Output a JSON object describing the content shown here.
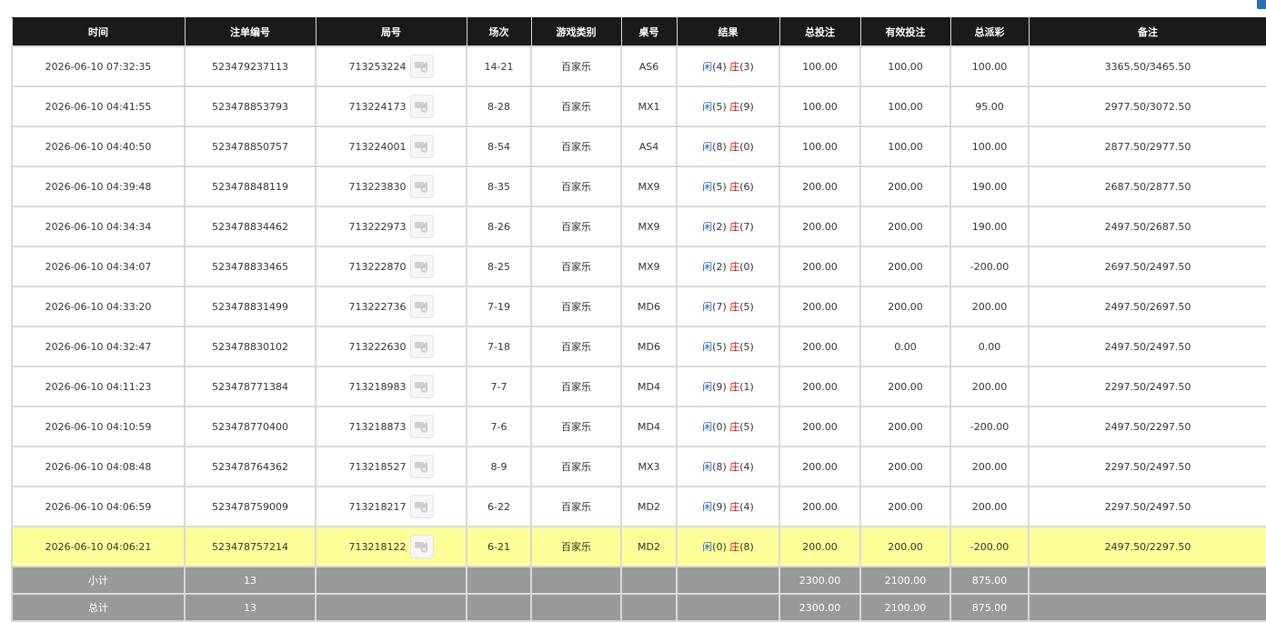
{
  "headers": [
    "时间",
    "注单编号",
    "局号",
    "场次",
    "游戏类别",
    "桌号",
    "结果",
    "总投注",
    "有效投注",
    "总派彩",
    "备注"
  ],
  "rows": [
    {
      "time": "2026-06-10 07:32:35",
      "bet_id": "523479237113",
      "round": "713253224",
      "session": "14-21",
      "game": "百家乐",
      "table": "AS6",
      "player_label": "闲",
      "player_val": "(4)",
      "banker_label": "庄",
      "banker_val": "(3)",
      "total_bet": "100.00",
      "valid_bet": "100.00",
      "payout": "100.00",
      "payout_neg": false,
      "note": "3365.50/3465.50",
      "highlight": false
    },
    {
      "time": "2026-06-10 04:41:55",
      "bet_id": "523478853793",
      "round": "713224173",
      "session": "8-28",
      "game": "百家乐",
      "table": "MX1",
      "player_label": "闲",
      "player_val": "(5)",
      "banker_label": "庄",
      "banker_val": "(9)",
      "total_bet": "100.00",
      "valid_bet": "100.00",
      "payout": "95.00",
      "payout_neg": false,
      "note": "2977.50/3072.50",
      "highlight": false
    },
    {
      "time": "2026-06-10 04:40:50",
      "bet_id": "523478850757",
      "round": "713224001",
      "session": "8-54",
      "game": "百家乐",
      "table": "AS4",
      "player_label": "闲",
      "player_val": "(8)",
      "banker_label": "庄",
      "banker_val": "(0)",
      "total_bet": "100.00",
      "valid_bet": "100.00",
      "payout": "100.00",
      "payout_neg": false,
      "note": "2877.50/2977.50",
      "highlight": false
    },
    {
      "time": "2026-06-10 04:39:48",
      "bet_id": "523478848119",
      "round": "713223830",
      "session": "8-35",
      "game": "百家乐",
      "table": "MX9",
      "player_label": "闲",
      "player_val": "(5)",
      "banker_label": "庄",
      "banker_val": "(6)",
      "total_bet": "200.00",
      "valid_bet": "200.00",
      "payout": "190.00",
      "payout_neg": false,
      "note": "2687.50/2877.50",
      "highlight": false
    },
    {
      "time": "2026-06-10 04:34:34",
      "bet_id": "523478834462",
      "round": "713222973",
      "session": "8-26",
      "game": "百家乐",
      "table": "MX9",
      "player_label": "闲",
      "player_val": "(2)",
      "banker_label": "庄",
      "banker_val": "(7)",
      "total_bet": "200.00",
      "valid_bet": "200.00",
      "payout": "190.00",
      "payout_neg": false,
      "note": "2497.50/2687.50",
      "highlight": false
    },
    {
      "time": "2026-06-10 04:34:07",
      "bet_id": "523478833465",
      "round": "713222870",
      "session": "8-25",
      "game": "百家乐",
      "table": "MX9",
      "player_label": "闲",
      "player_val": "(2)",
      "banker_label": "庄",
      "banker_val": "(0)",
      "total_bet": "200.00",
      "valid_bet": "200.00",
      "payout": "-200.00",
      "payout_neg": true,
      "note": "2697.50/2497.50",
      "highlight": false
    },
    {
      "time": "2026-06-10 04:33:20",
      "bet_id": "523478831499",
      "round": "713222736",
      "session": "7-19",
      "game": "百家乐",
      "table": "MD6",
      "player_label": "闲",
      "player_val": "(7)",
      "banker_label": "庄",
      "banker_val": "(5)",
      "total_bet": "200.00",
      "valid_bet": "200.00",
      "payout": "200.00",
      "payout_neg": false,
      "note": "2497.50/2697.50",
      "highlight": false
    },
    {
      "time": "2026-06-10 04:32:47",
      "bet_id": "523478830102",
      "round": "713222630",
      "session": "7-18",
      "game": "百家乐",
      "table": "MD6",
      "player_label": "闲",
      "player_val": "(5)",
      "banker_label": "庄",
      "banker_val": "(5)",
      "total_bet": "200.00",
      "valid_bet": "0.00",
      "payout": "0.00",
      "payout_neg": false,
      "note": "2497.50/2497.50",
      "highlight": false
    },
    {
      "time": "2026-06-10 04:11:23",
      "bet_id": "523478771384",
      "round": "713218983",
      "session": "7-7",
      "game": "百家乐",
      "table": "MD4",
      "player_label": "闲",
      "player_val": "(9)",
      "banker_label": "庄",
      "banker_val": "(1)",
      "total_bet": "200.00",
      "valid_bet": "200.00",
      "payout": "200.00",
      "payout_neg": false,
      "note": "2297.50/2497.50",
      "highlight": false
    },
    {
      "time": "2026-06-10 04:10:59",
      "bet_id": "523478770400",
      "round": "713218873",
      "session": "7-6",
      "game": "百家乐",
      "table": "MD4",
      "player_label": "闲",
      "player_val": "(0)",
      "banker_label": "庄",
      "banker_val": "(5)",
      "total_bet": "200.00",
      "valid_bet": "200.00",
      "payout": "-200.00",
      "payout_neg": true,
      "note": "2497.50/2297.50",
      "highlight": false
    },
    {
      "time": "2026-06-10 04:08:48",
      "bet_id": "523478764362",
      "round": "713218527",
      "session": "8-9",
      "game": "百家乐",
      "table": "MX3",
      "player_label": "闲",
      "player_val": "(8)",
      "banker_label": "庄",
      "banker_val": "(4)",
      "total_bet": "200.00",
      "valid_bet": "200.00",
      "payout": "200.00",
      "payout_neg": false,
      "note": "2297.50/2497.50",
      "highlight": false
    },
    {
      "time": "2026-06-10 04:06:59",
      "bet_id": "523478759009",
      "round": "713218217",
      "session": "6-22",
      "game": "百家乐",
      "table": "MD2",
      "player_label": "闲",
      "player_val": "(9)",
      "banker_label": "庄",
      "banker_val": "(4)",
      "total_bet": "200.00",
      "valid_bet": "200.00",
      "payout": "200.00",
      "payout_neg": false,
      "note": "2297.50/2497.50",
      "highlight": false
    },
    {
      "time": "2026-06-10 04:06:21",
      "bet_id": "523478757214",
      "round": "713218122",
      "session": "6-21",
      "game": "百家乐",
      "table": "MD2",
      "player_label": "闲",
      "player_val": "(0)",
      "banker_label": "庄",
      "banker_val": "(8)",
      "total_bet": "200.00",
      "valid_bet": "200.00",
      "payout": "-200.00",
      "payout_neg": true,
      "note": "2497.50/2297.50",
      "highlight": true
    }
  ],
  "totals": [
    {
      "label": "小计",
      "count": "13",
      "total_bet": "2300.00",
      "valid_bet": "2100.00",
      "payout": "875.00"
    },
    {
      "label": "总计",
      "count": "13",
      "total_bet": "2300.00",
      "valid_bet": "2100.00",
      "payout": "875.00"
    }
  ],
  "colors": {
    "header_bg": "#1a1a1a",
    "highlight_row": "#ffff99",
    "total_row": "#999999",
    "blue_text": "#1464d2",
    "red_text": "#e60000"
  },
  "icons": {
    "replay": "video-replay-icon"
  }
}
